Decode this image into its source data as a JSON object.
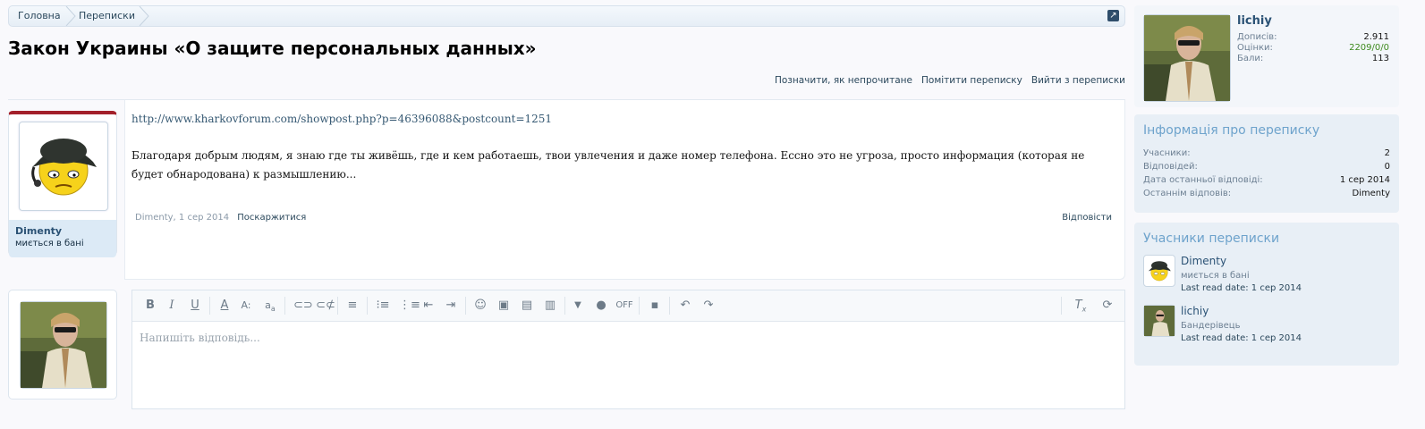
{
  "breadcrumb": {
    "items": [
      "Головна",
      "Переписки"
    ]
  },
  "page": {
    "title": "Закон Украины «О защите персональных данных»"
  },
  "actions": {
    "mark_unread": "Позначити, як непрочитане",
    "star": "Помітити переписку",
    "leave": "Вийти з переписки"
  },
  "post": {
    "author": "Dimenty",
    "author_title": "миється в бані",
    "link": "http://www.kharkovforum.com/showpost.php?p=46396088&postcount=1251",
    "text": "Благодаря добрым людям, я знаю где ты живёшь, где и кем работаешь, твои увлечения и даже номер телефона. Ессно это не угроза, просто информация (которая не будет обнародована) к размышлению...",
    "meta": "Dimenty, 1 сер 2014",
    "report": "Поскаржитися",
    "reply": "Відповісти"
  },
  "editor": {
    "placeholder": "Напишіть відповідь...",
    "toolbar_icons": [
      "bold-icon",
      "italic-icon",
      "underline-icon",
      "font-color-icon",
      "font-size-icon",
      "font-family-icon",
      "link-icon",
      "unlink-icon",
      "align-icon",
      "bullet-list-icon",
      "number-list-icon",
      "outdent-icon",
      "indent-icon",
      "smilie-icon",
      "image-icon",
      "media-icon",
      "more-icon",
      "dropdown-icon",
      "location-icon",
      "save-draft-icon",
      "undo-icon",
      "redo-icon",
      "remove-format-icon",
      "toggle-bbcode-icon"
    ],
    "toggle_label": "OFF"
  },
  "sidebar": {
    "user": {
      "name": "lichiy",
      "stats": [
        {
          "label": "Дописів:",
          "value": "2.911"
        },
        {
          "label": "Оцінки:",
          "value": "2209/0/0"
        },
        {
          "label": "Бали:",
          "value": "113"
        }
      ]
    },
    "info": {
      "title": "Інформація про переписку",
      "rows": [
        {
          "label": "Учасники:",
          "value": "2"
        },
        {
          "label": "Відповідей:",
          "value": "0"
        },
        {
          "label": "Дата останньої відповіді:",
          "value": "1 сер 2014"
        },
        {
          "label": "Останнім відповів:",
          "value": "Dimenty"
        }
      ]
    },
    "participants": {
      "title": "Учасники переписки",
      "items": [
        {
          "name": "Dimenty",
          "title": "миється в бані",
          "read": "Last read date: 1 сер 2014"
        },
        {
          "name": "lichiy",
          "title": "Бандерівець",
          "read": "Last read date: 1 сер 2014"
        }
      ]
    }
  },
  "colors": {
    "accent": "#2b5275",
    "header_bar": "#a3202a",
    "sidebar_heading": "#6ea3cc"
  }
}
